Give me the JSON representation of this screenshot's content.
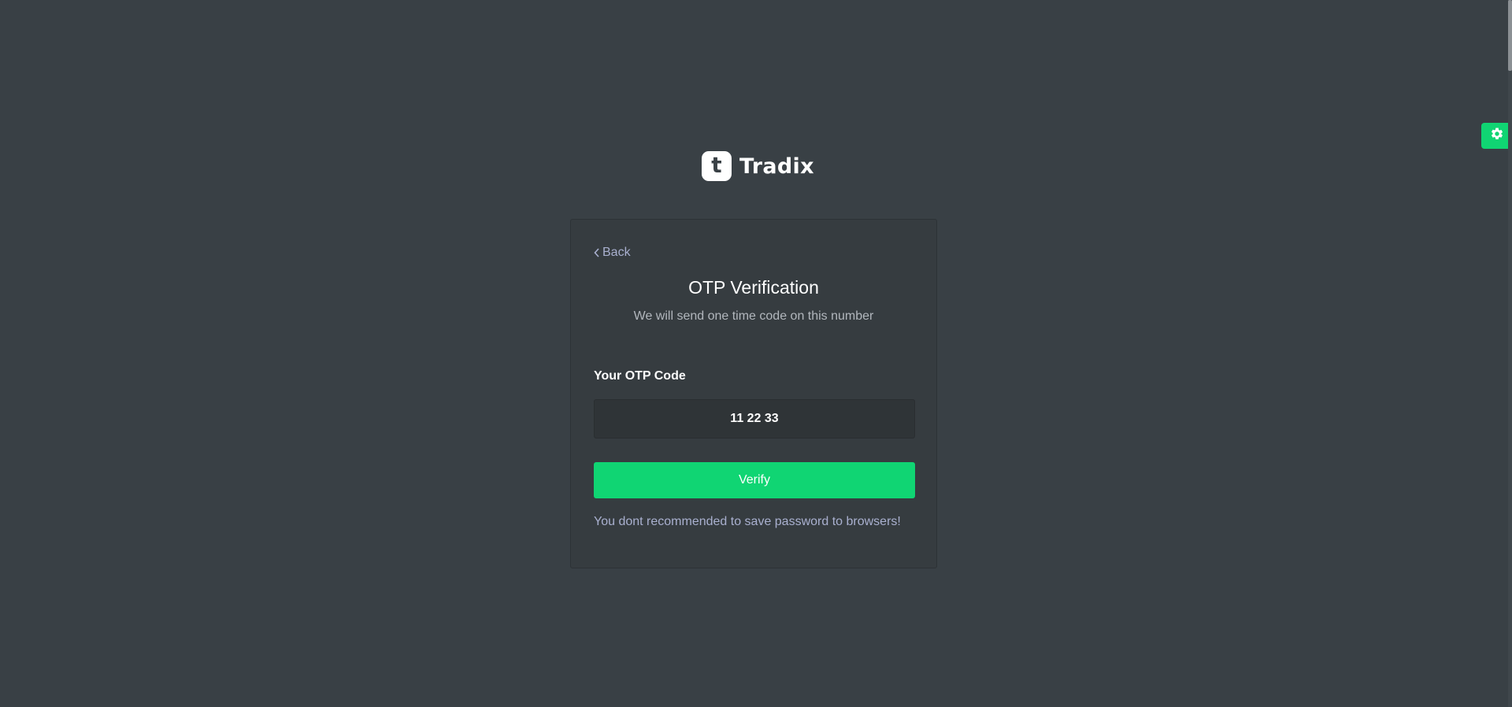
{
  "brand": {
    "logo_letter": "t",
    "name": "Tradix"
  },
  "card": {
    "back_label": "Back",
    "title": "OTP Verification",
    "subtitle": "We will send one time code on this number",
    "otp_label": "Your OTP Code",
    "otp_value": "11 22 33",
    "verify_label": "Verify",
    "note": "You dont recommended to save password to browsers!"
  },
  "icons": {
    "back": "chevron-left-icon",
    "settings": "gear-icon"
  },
  "colors": {
    "background": "#394045",
    "card": "#363c40",
    "accent": "#10d573",
    "link": "#a9b0cf"
  }
}
